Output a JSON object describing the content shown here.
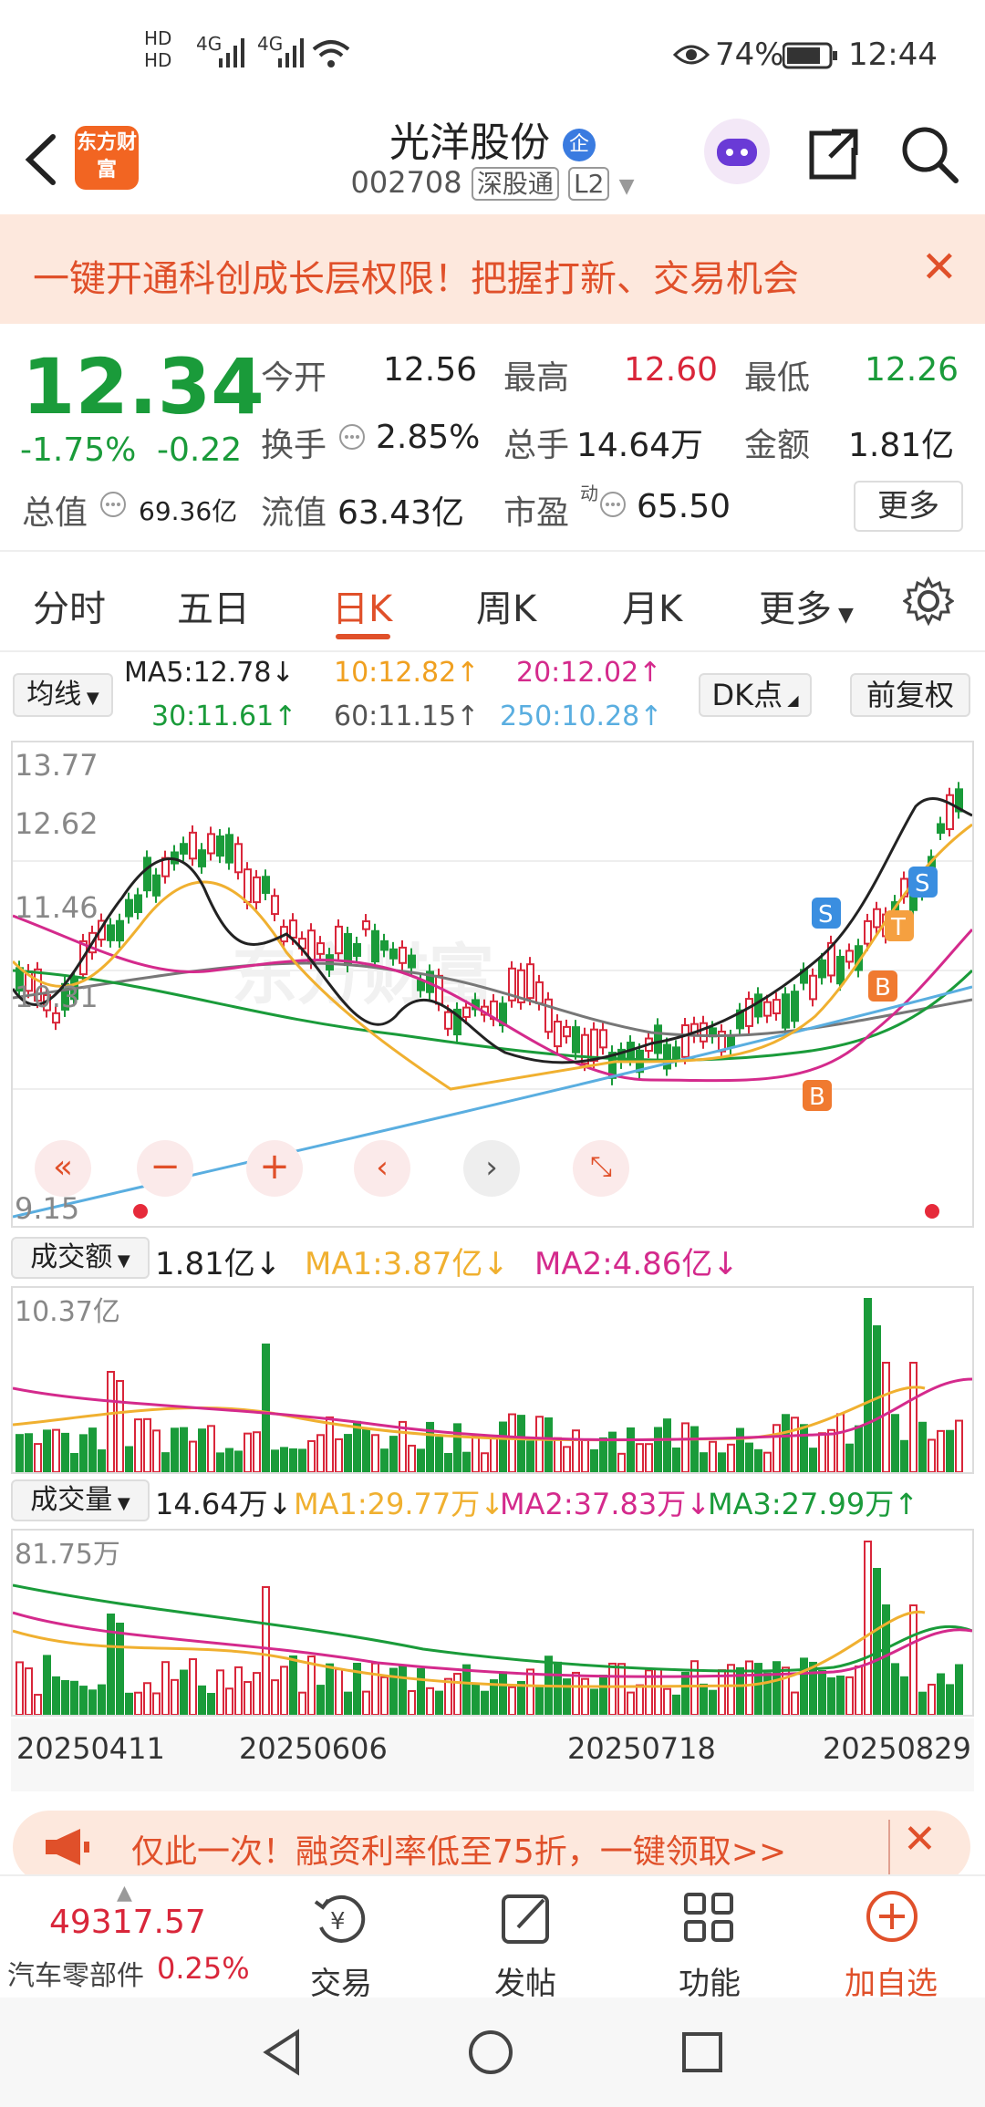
{
  "status": {
    "battery": "74%",
    "time": "12:44",
    "net1": "4G",
    "net2": "4G"
  },
  "header": {
    "logo": "东方财富",
    "name": "光洋股份",
    "badge": "企",
    "code": "002708",
    "tag1": "深股通",
    "tag2": "L2"
  },
  "banner": {
    "text": "一键开通科创成长层权限！把握打新、交易机会"
  },
  "quote": {
    "price": "12.34",
    "pct": "-1.75%",
    "chg": "-0.22",
    "open_label": "今开",
    "open": "12.56",
    "high_label": "最高",
    "high": "12.60",
    "low_label": "最低",
    "low": "12.26",
    "turnover_label": "换手",
    "turnover": "2.85%",
    "vol_label": "总手",
    "vol": "14.64万",
    "amt_label": "金额",
    "amt": "1.81亿",
    "mcap_label": "总值",
    "mcap": "69.36亿",
    "float_label": "流值",
    "float": "63.43亿",
    "pe_label": "市盈",
    "pe_sup": "动",
    "pe": "65.50",
    "more": "更多"
  },
  "tabs": [
    "分时",
    "五日",
    "日K",
    "周K",
    "月K",
    "更多"
  ],
  "kline": {
    "ma_select": "均线",
    "ma5": "MA5:12.78",
    "ma10": "10:12.82",
    "ma20": "20:12.02",
    "ma30": "30:11.61",
    "ma60": "60:11.15",
    "ma250": "250:10.28",
    "dk": "DK点",
    "adjust": "前复权",
    "y_labels": [
      "13.77",
      "12.62",
      "11.46",
      "10.31",
      "9.15"
    ],
    "watermark": "东方财富"
  },
  "amount": {
    "select": "成交额",
    "value": "1.81亿",
    "ma1": "MA1:3.87亿",
    "ma2": "MA2:4.86亿",
    "top": "10.37亿"
  },
  "volume": {
    "select": "成交量",
    "value": "14.64万",
    "ma1": "MA1:29.77万",
    "ma2": "MA2:37.83万",
    "ma3": "MA3:27.99万",
    "top": "81.75万"
  },
  "dates": [
    "20250411",
    "20250606",
    "20250718",
    "20250829"
  ],
  "promo": {
    "text": "仅此一次！融资利率低至75折，一键领取>>"
  },
  "bottom": {
    "index_value": "49317.57",
    "index_name": "汽车零部件",
    "index_pct": "0.25%",
    "trade": "交易",
    "post": "发帖",
    "func": "功能",
    "add": "加自选"
  },
  "colors": {
    "up": "#d9263a",
    "down": "#1a9b3a",
    "accent": "#e0502a"
  }
}
